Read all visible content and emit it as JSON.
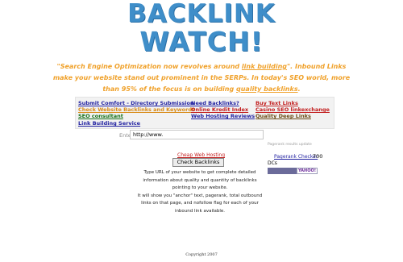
{
  "logo": {
    "line1": "BACKLINK",
    "line2": "WATCH!"
  },
  "tagline": {
    "part1": "\"Search Engine Optimization now revolves around ",
    "link1": "link building",
    "part2": "\". Inbound Links make your website stand out prominent in the SERPs. In today's SEO world, more than 95% of the focus is on building ",
    "link2": "quality backlinks",
    "part3": "."
  },
  "links": {
    "submit_comfort": "Submit Comfort - Directory Submission",
    "need_backlinks": "Need Backlinks?",
    "buy_text_links": "Buy Text Links",
    "check_website": "Check Website Backlinks and Keywords",
    "online_kredit": "Online Kredit Index",
    "casino_seo": "Casino SEO linkexchange",
    "seo_consultant": "SEO consultant",
    "web_hosting": "Web Hosting Reviews",
    "quality_deep": "Quality Deep Links",
    "link_building_service": "Link Building Service"
  },
  "form": {
    "enter_url_label": "Enter URL:",
    "url_value": "http://www.",
    "cheap_hosting": "Cheap Web Hosting",
    "check_button": "Check Backlinks"
  },
  "description": {
    "line1": "Type URL of your website to get complete detailed",
    "line2": "information about quality and quantity of backlinks",
    "line3": "pointing to your website.",
    "line4": "It will show you \"anchor\" text, pagerank, total outbound",
    "line5": "links on that page, and nofollow flag for each of your",
    "line6": "inbound link available."
  },
  "sidebar": {
    "note": "Pagerank results update",
    "pagerank_link": "Pagerank Checker",
    "pagerank_value": "700",
    "dcs": "DCs",
    "badge_a": "",
    "badge_b": "YAHOO!"
  },
  "footer": {
    "copyright": "Copyright 2007"
  },
  "colors": {
    "logo": "#3f8ec9",
    "tagline": "#f0a12a",
    "link_blue": "#1f1fa0",
    "link_orange": "#d98c19",
    "link_green": "#157015",
    "link_red": "#c21e1e"
  }
}
